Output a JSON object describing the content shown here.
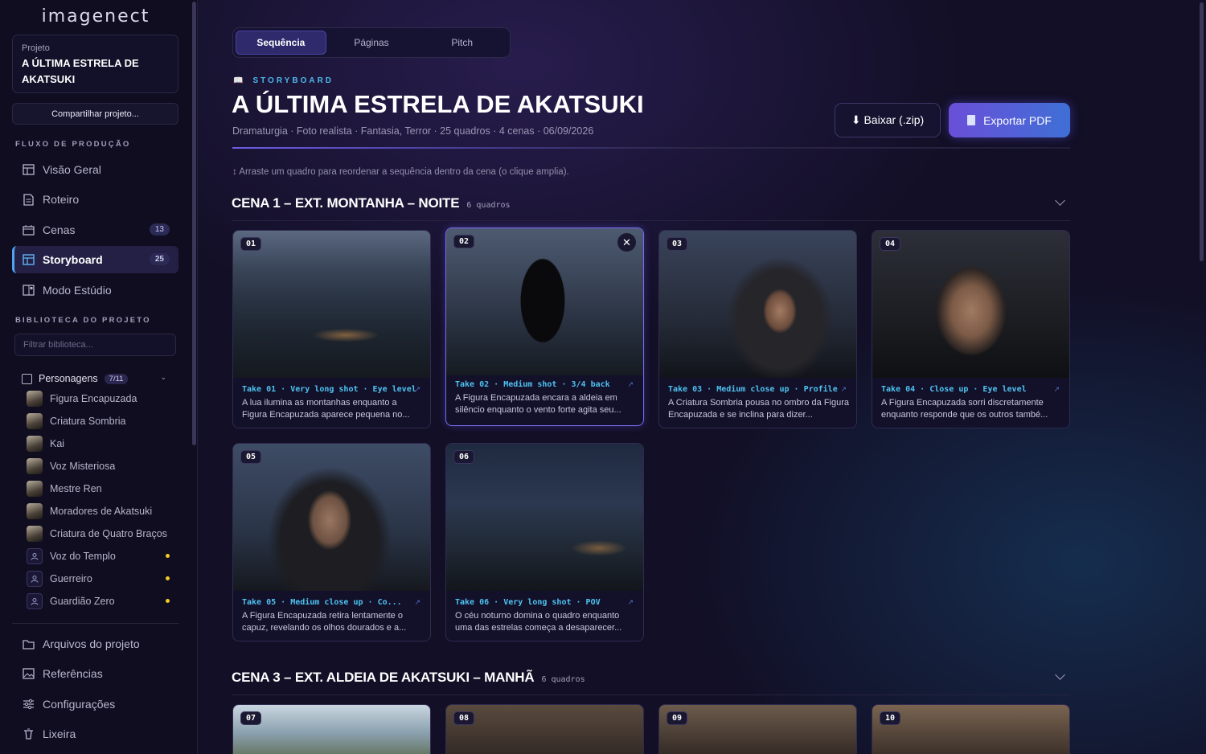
{
  "app": {
    "logo": "imagenect"
  },
  "project": {
    "label": "Projeto",
    "title": "A ÚLTIMA ESTRELA DE AKATSUKI",
    "share_label": "Compartilhar projeto..."
  },
  "sidebar": {
    "section_flow": "FLUXO DE PRODUÇÃO",
    "flow_items": [
      {
        "label": "Visão Geral",
        "icon": "overview-icon"
      },
      {
        "label": "Roteiro",
        "icon": "script-icon"
      },
      {
        "label": "Cenas",
        "icon": "scenes-icon",
        "count": "13"
      },
      {
        "label": "Storyboard",
        "icon": "storyboard-icon",
        "count": "25",
        "active": true
      },
      {
        "label": "Modo Estúdio",
        "icon": "studio-icon"
      }
    ],
    "section_library": "BIBLIOTECA DO PROJETO",
    "filter_placeholder": "Filtrar biblioteca...",
    "characters": {
      "label": "Personagens",
      "count": "7/11",
      "items": [
        {
          "name": "Figura Encapuzada",
          "avatar": "image"
        },
        {
          "name": "Criatura Sombria",
          "avatar": "image"
        },
        {
          "name": "Kai",
          "avatar": "image"
        },
        {
          "name": "Voz Misteriosa",
          "avatar": "image"
        },
        {
          "name": "Mestre Ren",
          "avatar": "image"
        },
        {
          "name": "Moradores de Akatsuki",
          "avatar": "image"
        },
        {
          "name": "Criatura de Quatro Braços",
          "avatar": "image"
        },
        {
          "name": "Voz do Templo",
          "avatar": "placeholder",
          "pending": true
        },
        {
          "name": "Guerreiro",
          "avatar": "placeholder",
          "pending": true
        },
        {
          "name": "Guardião Zero",
          "avatar": "placeholder",
          "pending": true
        }
      ]
    },
    "bottom_items": [
      {
        "label": "Arquivos do projeto",
        "icon": "folder-icon"
      },
      {
        "label": "Referências",
        "icon": "image-icon"
      },
      {
        "label": "Configurações",
        "icon": "sliders-icon"
      },
      {
        "label": "Lixeira",
        "icon": "trash-icon"
      }
    ]
  },
  "tabs": [
    {
      "label": "Sequência",
      "active": true
    },
    {
      "label": "Páginas"
    },
    {
      "label": "Pitch"
    }
  ],
  "header": {
    "section_label": "STORYBOARD",
    "title": "A ÚLTIMA ESTRELA DE AKATSUKI",
    "meta": "Dramaturgia · Foto realista · Fantasia, Terror · 25 quadros · 4 cenas · 06/09/2026",
    "download_label": "⬇ Baixar (.zip)",
    "export_label": "Exportar PDF"
  },
  "hint": "↕ Arraste um quadro para reordenar a sequência dentro da cena (o clique amplia).",
  "scenes": [
    {
      "title": "CENA 1 – EXT. MONTANHA – NOITE",
      "count": "6 quadros",
      "frames": [
        {
          "num": "01",
          "take": "Take 01 · Very long shot · Eye level",
          "desc": "A lua ilumina as montanhas enquanto a Figura Encapuzada aparece pequena no...",
          "scene_art": "mountain"
        },
        {
          "num": "02",
          "take": "Take 02 · Medium shot · 3/4 back",
          "desc": "A Figura Encapuzada encara a aldeia em silêncio enquanto o vento forte agita seu...",
          "scene_art": "cloak",
          "selected": true
        },
        {
          "num": "03",
          "take": "Take 03 · Medium close up · Profile",
          "desc": "A Criatura Sombria pousa no ombro da Figura Encapuzada e se inclina para dizer...",
          "scene_art": "face"
        },
        {
          "num": "04",
          "take": "Take 04 · Close up · Eye level",
          "desc": "A Figura Encapuzada sorri discretamente enquanto responde que os outros també...",
          "scene_art": "close"
        },
        {
          "num": "05",
          "take": "Take 05 · Medium close up · Co...",
          "desc": "A Figura Encapuzada retira lentamente o capuz, revelando os olhos dourados e a...",
          "scene_art": "hood"
        },
        {
          "num": "06",
          "take": "Take 06 · Very long shot · POV",
          "desc": "O céu noturno domina o quadro enquanto uma das estrelas começa a desaparecer...",
          "scene_art": "night"
        }
      ]
    },
    {
      "title": "CENA 3 – EXT. ALDEIA DE AKATSUKI – MANHÃ",
      "count": "6 quadros",
      "frames": [
        {
          "num": "07",
          "scene_art": "village"
        },
        {
          "num": "08",
          "scene_art": "man"
        },
        {
          "num": "09",
          "scene_art": "boy"
        },
        {
          "num": "10",
          "scene_art": "boy2"
        }
      ]
    }
  ],
  "colors": {
    "accent": "#4fa3f0",
    "take_text": "#4ec3f0",
    "export_from": "#6a4fd8",
    "export_to": "#3f6fd6",
    "pending_dot": "#f2cb2a"
  }
}
